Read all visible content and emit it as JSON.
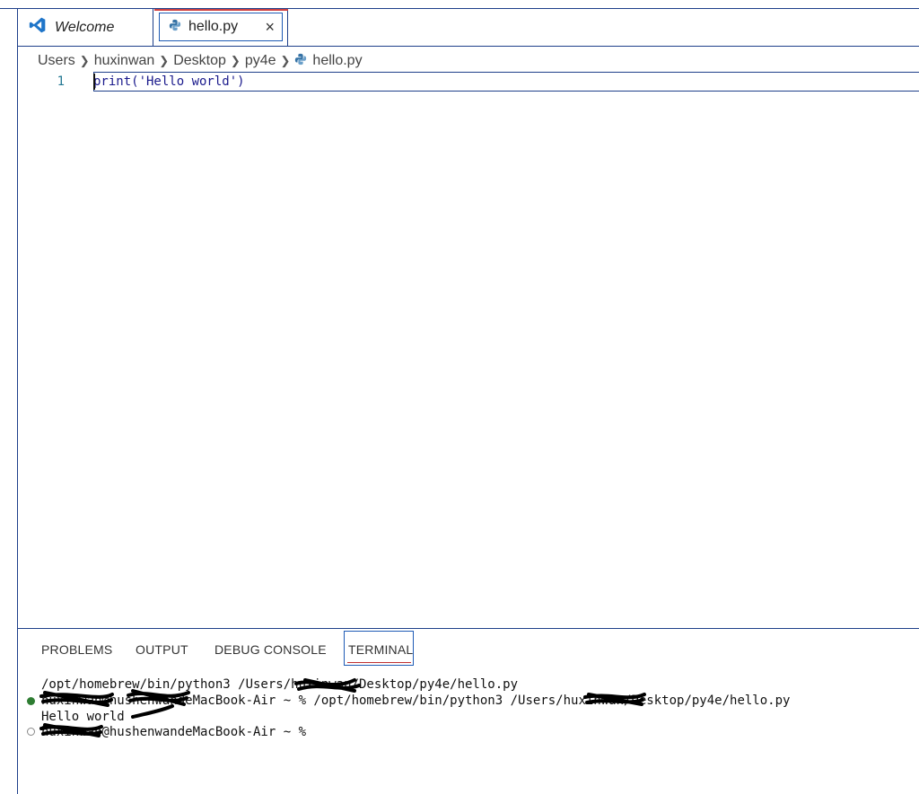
{
  "tabs": [
    {
      "label": "Welcome",
      "icon": "vscode-logo-icon",
      "active": false
    },
    {
      "label": "hello.py",
      "icon": "python-icon",
      "active": true,
      "close": "×"
    }
  ],
  "breadcrumb": [
    "Users",
    "huxinwan",
    "Desktop",
    "py4e",
    "hello.py"
  ],
  "editor": {
    "line_numbers": [
      "1"
    ],
    "code": [
      "print('Hello world')"
    ]
  },
  "panel": {
    "tabs": [
      "PROBLEMS",
      "OUTPUT",
      "DEBUG CONSOLE",
      "TERMINAL"
    ],
    "active_tab": "TERMINAL"
  },
  "terminal": {
    "lines": [
      "/opt/homebrew/bin/python3 /Users/huxinwan/Desktop/py4e/hello.py",
      "huxinwan@hushenwandeMacBook-Air ~ % /opt/homebrew/bin/python3 /Users/huxinwan/Desktop/py4e/hello.py",
      "Hello world",
      "huxinwan@hushenwandeMacBook-Air ~ %"
    ]
  },
  "colors": {
    "frame": "#1e3f8a",
    "accent_blue": "#1e5bb5",
    "active_underline": "#c03030",
    "code_text": "#1a1a8c",
    "success_dot": "#2e7d32"
  }
}
